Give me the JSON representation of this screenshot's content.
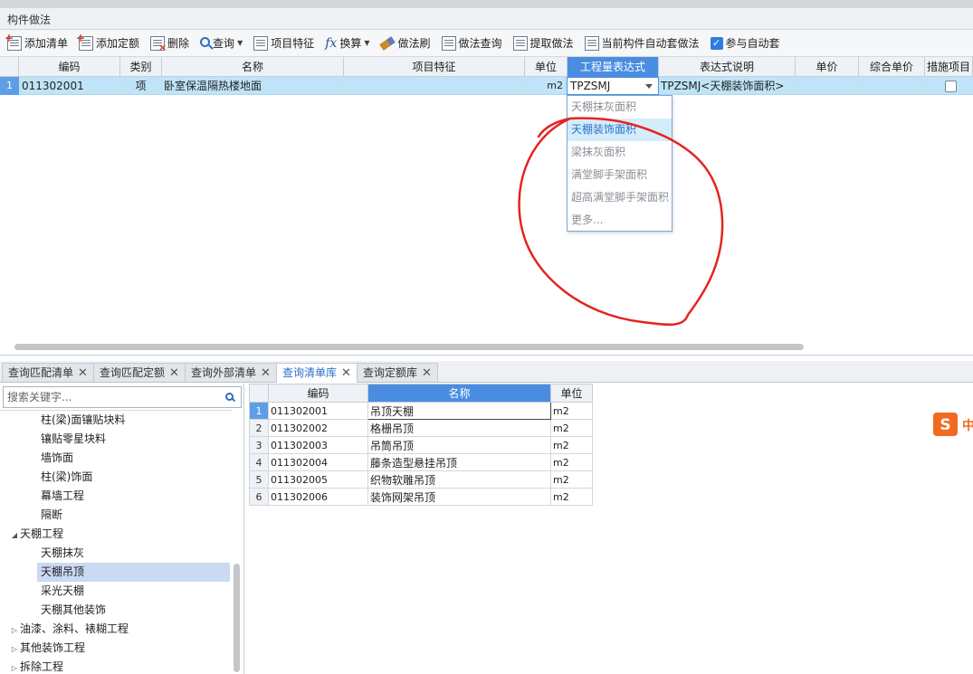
{
  "panel": {
    "title": "构件做法"
  },
  "toolbar": {
    "add_list": "添加清单",
    "add_quota": "添加定额",
    "delete": "删除",
    "query": "查询",
    "item_feature": "项目特征",
    "convert": "换算",
    "method_brush": "做法刷",
    "method_query": "做法查询",
    "extract_method": "提取做法",
    "auto_apply": "当前构件自动套做法",
    "join_auto": "参与自动套",
    "join_auto_checked": true
  },
  "grid": {
    "columns": [
      "编码",
      "类别",
      "名称",
      "项目特征",
      "单位",
      "工程量表达式",
      "表达式说明",
      "单价",
      "综合单价",
      "措施项目"
    ],
    "row": {
      "num": "1",
      "code": "011302001",
      "category": "项",
      "name": "卧室保温隔热楼地面",
      "feature": "",
      "unit": "m2",
      "expression": "TPZSMJ",
      "expression_desc": "TPZSMJ<天棚装饰面积>",
      "price": "",
      "comp_price": "",
      "measure_checked": false
    }
  },
  "dropdown": {
    "items": [
      "天棚抹灰面积",
      "天棚装饰面积",
      "梁抹灰面积",
      "满堂脚手架面积",
      "超高满堂脚手架面积",
      "更多..."
    ],
    "selected_index": 1
  },
  "tabs": [
    {
      "label": "查询匹配清单",
      "active": false
    },
    {
      "label": "查询匹配定额",
      "active": false
    },
    {
      "label": "查询外部清单",
      "active": false
    },
    {
      "label": "查询清单库",
      "active": true
    },
    {
      "label": "查询定额库",
      "active": false
    }
  ],
  "search": {
    "placeholder": "搜索关键字..."
  },
  "tree": [
    {
      "label": "柱(梁)面镶贴块料",
      "level": 2,
      "arrow": ""
    },
    {
      "label": "镶贴零星块料",
      "level": 2,
      "arrow": ""
    },
    {
      "label": "墙饰面",
      "level": 2,
      "arrow": ""
    },
    {
      "label": "柱(梁)饰面",
      "level": 2,
      "arrow": ""
    },
    {
      "label": "幕墙工程",
      "level": 2,
      "arrow": ""
    },
    {
      "label": "隔断",
      "level": 2,
      "arrow": ""
    },
    {
      "label": "天棚工程",
      "level": 1,
      "arrow": "expanded"
    },
    {
      "label": "天棚抹灰",
      "level": 2,
      "arrow": ""
    },
    {
      "label": "天棚吊顶",
      "level": 2,
      "arrow": "",
      "selected": true
    },
    {
      "label": "采光天棚",
      "level": 2,
      "arrow": ""
    },
    {
      "label": "天棚其他装饰",
      "level": 2,
      "arrow": ""
    },
    {
      "label": "油漆、涂料、裱糊工程",
      "level": 1,
      "arrow": "collapsed"
    },
    {
      "label": "其他装饰工程",
      "level": 1,
      "arrow": "collapsed"
    },
    {
      "label": "拆除工程",
      "level": 1,
      "arrow": "collapsed"
    }
  ],
  "results": {
    "columns": [
      "编码",
      "名称",
      "单位"
    ],
    "rows": [
      {
        "num": "1",
        "code": "011302001",
        "name": "吊顶天棚",
        "unit": "m2"
      },
      {
        "num": "2",
        "code": "011302002",
        "name": "格栅吊顶",
        "unit": "m2"
      },
      {
        "num": "3",
        "code": "011302003",
        "name": "吊筒吊顶",
        "unit": "m2"
      },
      {
        "num": "4",
        "code": "011302004",
        "name": "藤条造型悬挂吊顶",
        "unit": "m2"
      },
      {
        "num": "5",
        "code": "011302005",
        "name": "织物软雕吊顶",
        "unit": "m2"
      },
      {
        "num": "6",
        "code": "011302006",
        "name": "装饰网架吊顶",
        "unit": "m2"
      }
    ],
    "selected_index": 0
  },
  "ime": {
    "badge_glyph": "S",
    "badge_text": "中"
  },
  "colors": {
    "accent": "#4a8de0",
    "selected_row": "#bfe4f7",
    "annotation_red": "#e52420",
    "tree_selected": "#c9daf2",
    "ime_orange": "#f26a21"
  },
  "icons": {
    "add_list": "sheet-plus-icon",
    "add_quota": "sheet-plus-icon",
    "delete": "sheet-delete-icon",
    "query": "magnifier-icon",
    "item_feature": "sheet-icon",
    "convert": "fx-icon",
    "method_brush": "brush-icon",
    "method_query": "sheet-magnifier-icon",
    "extract_method": "sheet-arrow-icon",
    "auto_apply": "sheet-grid-icon",
    "join_auto": "checkbox-icon",
    "search": "search-icon"
  }
}
